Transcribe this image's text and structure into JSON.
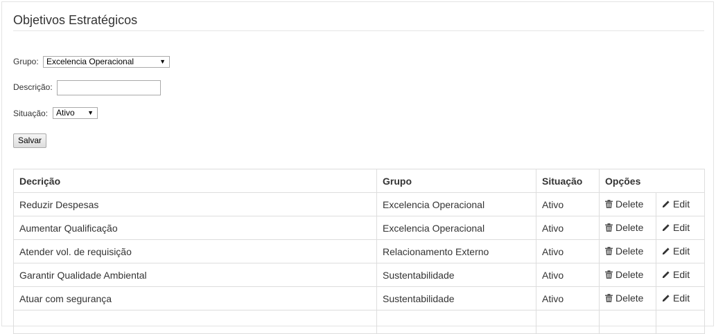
{
  "page": {
    "title": "Objetivos Estratégicos"
  },
  "form": {
    "grupo_label": "Grupo:",
    "grupo_value": "Excelencia Operacional",
    "descricao_label": "Descrição:",
    "descricao_value": "",
    "situacao_label": "Situação:",
    "situacao_value": "Ativo",
    "save_label": "Salvar"
  },
  "table": {
    "headers": {
      "descricao": "Decrição",
      "grupo": "Grupo",
      "situacao": "Situação",
      "opcoes": "Opções"
    },
    "action_delete": "Delete",
    "action_edit": "Edit",
    "rows": [
      {
        "descricao": "Reduzir Despesas",
        "grupo": "Excelencia Operacional",
        "situacao": "Ativo"
      },
      {
        "descricao": "Aumentar Qualificação",
        "grupo": "Excelencia Operacional",
        "situacao": "Ativo"
      },
      {
        "descricao": "Atender vol. de requisição",
        "grupo": "Relacionamento Externo",
        "situacao": "Ativo"
      },
      {
        "descricao": "Garantir Qualidade Ambiental",
        "grupo": "Sustentabilidade",
        "situacao": "Ativo"
      },
      {
        "descricao": "Atuar com segurança",
        "grupo": "Sustentabilidade",
        "situacao": "Ativo"
      },
      {
        "descricao": "",
        "grupo": "",
        "situacao": ""
      }
    ]
  },
  "icons": {
    "delete": "trash-icon",
    "edit": "pencil-icon"
  }
}
